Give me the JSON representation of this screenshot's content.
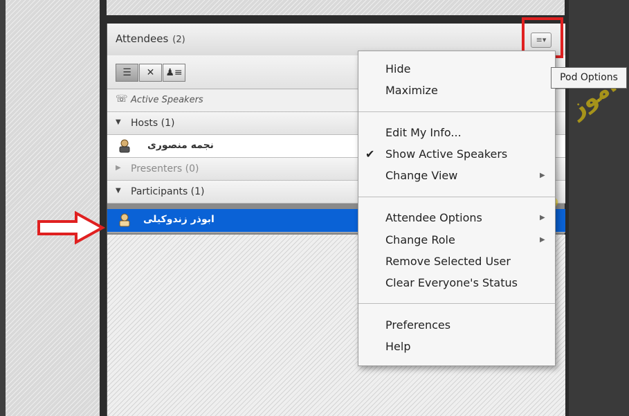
{
  "pod": {
    "title": "Attendees",
    "count": "(2)",
    "options_icon": "menu-lines-icon",
    "speakers_label": "Active Speakers",
    "groups": {
      "hosts": "Hosts (1)",
      "presenters": "Presenters (0)",
      "participants": "Participants (1)"
    },
    "host_user": "نجمه منصوری",
    "participant_user": "ابوذر زندوکیلی"
  },
  "menu": {
    "items": [
      {
        "label": "Hide"
      },
      {
        "label": "Maximize"
      },
      {
        "label": "Edit My Info..."
      },
      {
        "label": "Show Active Speakers",
        "checked": true
      },
      {
        "label": "Change View",
        "submenu": true
      },
      {
        "label": "Attendee Options",
        "submenu": true
      },
      {
        "label": "Change Role",
        "submenu": true
      },
      {
        "label": "Remove Selected User"
      },
      {
        "label": "Clear Everyone's Status"
      },
      {
        "label": "Preferences"
      },
      {
        "label": "Help"
      }
    ],
    "check_glyph": "✔",
    "submenu_glyph": "▶"
  },
  "tooltip": "Pod Options",
  "colors": {
    "selected_row": "#0a62d6",
    "highlight": "#e02020"
  }
}
